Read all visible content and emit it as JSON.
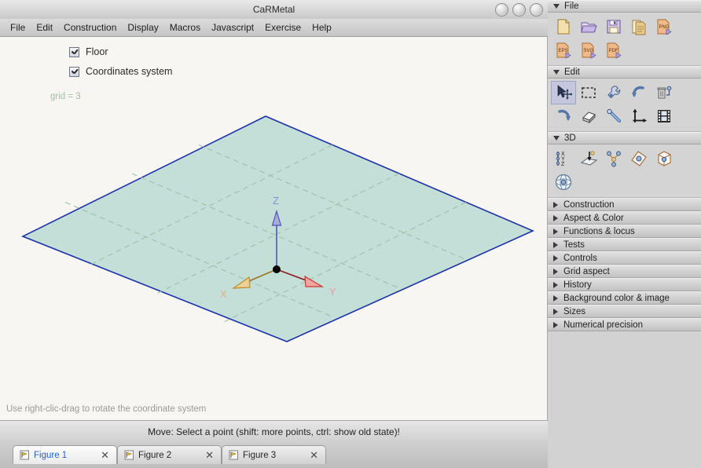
{
  "window": {
    "title": "CaRMetal",
    "buttons": [
      "minimize",
      "maximize",
      "close"
    ]
  },
  "menubar": {
    "items": [
      "File",
      "Edit",
      "Construction",
      "Display",
      "Macros",
      "Javascript",
      "Exercise",
      "Help"
    ]
  },
  "toolbar_right": {
    "monkey_icon": "monkey-icon",
    "view_buttons": [
      {
        "name": "view-sidebar-left-icon",
        "selected": false
      },
      {
        "name": "view-toolbar-top-icon",
        "selected": false
      },
      {
        "name": "view-sidebar-right-icon",
        "selected": true
      }
    ]
  },
  "canvas": {
    "options": [
      {
        "label": "Floor",
        "checked": true
      },
      {
        "label": "Coordinates system",
        "checked": true
      }
    ],
    "grid_label": "grid = 3",
    "hint": "Use right-clic-drag to rotate the coordinate system",
    "axes": [
      {
        "name": "Z",
        "color": "#6a6ec4"
      },
      {
        "name": "X",
        "color": "#d9a95e"
      },
      {
        "name": "Y",
        "color": "#e08a8a"
      }
    ],
    "floor": {
      "fill": "#c4ded8",
      "border": "#1b32a8",
      "grid_color": "#9ec0a8"
    },
    "origin_color": "#000000"
  },
  "statusbar": {
    "message": "Move: Select a point (shift: more points, ctrl: show old state)!"
  },
  "tabs": {
    "items": [
      {
        "label": "Figure 1",
        "active": true,
        "closable": true
      },
      {
        "label": "Figure 2",
        "active": false,
        "closable": true
      },
      {
        "label": "Figure 3",
        "active": false,
        "closable": true
      }
    ],
    "nav": {
      "prev_icon": "arrow-left-icon",
      "next_icon": "arrow-right-icon"
    },
    "extra_buttons": [
      {
        "name": "comment-icon"
      },
      {
        "name": "hammer-tools-icon"
      }
    ]
  },
  "panel": {
    "sections": [
      {
        "label": "File",
        "expanded": true,
        "tools": [
          {
            "name": "new-file-icon"
          },
          {
            "name": "open-folder-icon"
          },
          {
            "name": "save-icon"
          },
          {
            "name": "duplicate-document-icon"
          },
          {
            "name": "export-png-icon",
            "text": "PNG"
          },
          {
            "name": "export-eps-icon",
            "text": "EPS"
          },
          {
            "name": "export-svg-icon",
            "text": "SVG"
          },
          {
            "name": "export-pdf-icon",
            "text": "PDF"
          }
        ]
      },
      {
        "label": "Edit",
        "expanded": true,
        "tools": [
          {
            "name": "move-select-icon",
            "selected": true
          },
          {
            "name": "selection-rectangle-icon"
          },
          {
            "name": "wrench-properties-icon"
          },
          {
            "name": "undo-icon"
          },
          {
            "name": "delete-object-icon"
          },
          {
            "name": "redo-icon"
          },
          {
            "name": "eraser-icon"
          },
          {
            "name": "magic-wand-icon"
          },
          {
            "name": "axes-icon"
          },
          {
            "name": "film-animation-icon"
          }
        ]
      },
      {
        "label": "3D",
        "expanded": true,
        "tools": [
          {
            "name": "xyz-axis-icon",
            "text": "XYZ"
          },
          {
            "name": "plane-icon"
          },
          {
            "name": "points-graph-icon"
          },
          {
            "name": "polygon-3d-icon"
          },
          {
            "name": "cube-icon"
          },
          {
            "name": "sphere-icon"
          }
        ]
      }
    ],
    "collapsed_sections": [
      "Construction",
      "Aspect & Color",
      "Functions & locus",
      "Tests",
      "Controls",
      "Grid aspect",
      "History",
      "Background color & image",
      "Sizes",
      "Numerical precision"
    ]
  }
}
